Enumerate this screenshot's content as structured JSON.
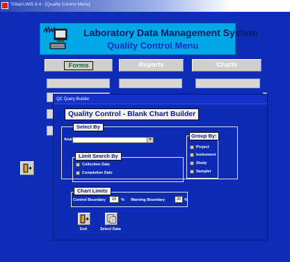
{
  "window": {
    "title": "Tribal-LIMS 8.4 - [Quality Control Menu]"
  },
  "header": {
    "title": "Laboratory Data Management System",
    "subtitle": "Quality Control Menu"
  },
  "nav": {
    "forms": "Forms",
    "reports": "Reports",
    "charts": "Charts"
  },
  "dialog": {
    "title": "QC Query Builder",
    "heading": "Quality Control - Blank Chart Builder",
    "select_by": {
      "label": "Select By",
      "analyte_label": "Analyte:",
      "analyte_value": ""
    },
    "limit_search_by": {
      "label": "Limit Search By",
      "options": [
        "Collection Date",
        "Completion Date"
      ]
    },
    "group_by": {
      "label": "Group By:",
      "options": [
        "Project",
        "Instrument",
        "Study",
        "Sampler"
      ]
    },
    "chart_limits": {
      "label": "Chart Limits",
      "control_boundary_label": "Control Boundary",
      "control_boundary_value": "15",
      "warning_boundary_label": "Warning Boundary",
      "warning_boundary_value": "30",
      "percent": "%"
    },
    "buttons": {
      "exit": "Exit",
      "select_data": "Select Data"
    }
  }
}
